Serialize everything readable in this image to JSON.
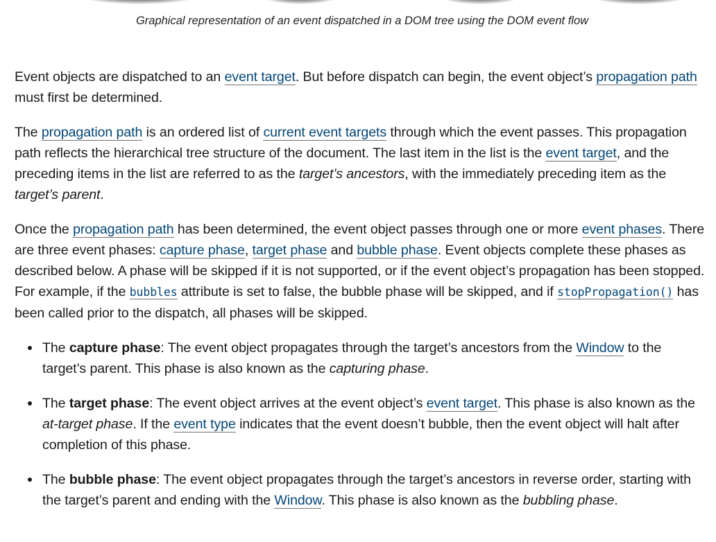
{
  "figure": {
    "caption": "Graphical representation of an event dispatched in a DOM tree using the DOM event flow"
  },
  "p1": {
    "t1": "Event objects are dispatched to an ",
    "l1": "event target",
    "t2": ". But before dispatch can begin, the event object’s ",
    "l2": "propagation path",
    "t3": " must first be determined."
  },
  "p2": {
    "t1": "The ",
    "l1": "propagation path",
    "t2": " is an ordered list of ",
    "l2": "current event targets",
    "t3": " through which the event passes. This propagation path reflects the hierarchical tree structure of the document. The last item in the list is the ",
    "l3": "event target",
    "t4": ", and the preceding items in the list are referred to as the ",
    "e1": "target’s ancestors",
    "t5": ", with the immediately preceding item as the ",
    "e2": "target’s parent",
    "t6": "."
  },
  "p3": {
    "t1": "Once the ",
    "l1": "propagation path",
    "t2": " has been determined, the event object passes through one or more ",
    "l2": "event phases",
    "t3": ". There are three event phases: ",
    "l3": "capture phase",
    "t4": ", ",
    "l4": "target phase",
    "t5": " and ",
    "l5": "bubble phase",
    "t6": ". Event objects complete these phases as described below. A phase will be skipped if it is not supported, or if the event object’s propagation has been stopped. For example, if the ",
    "c1": "bubbles",
    "t7": " attribute is set to false, the bubble phase will be skipped, and if ",
    "c2": "stopPropagation()",
    "t8": " has been called prior to the dispatch, all phases will be skipped."
  },
  "phases": [
    {
      "t1": "The ",
      "b1": "capture phase",
      "t2": ": The event object propagates through the target’s ancestors from the ",
      "l1": "Window",
      "t3": " to the target’s parent. This phase is also known as the ",
      "e1": "capturing phase",
      "t4": "."
    },
    {
      "t1": "The ",
      "b1": "target phase",
      "t2": ": The event object arrives at the event object’s ",
      "l1": "event target",
      "t3": ". This phase is also known as the ",
      "e1": "at-target phase",
      "t4": ". If the ",
      "l2": "event type",
      "t5": " indicates that the event doesn’t bubble, then the event object will halt after completion of this phase."
    },
    {
      "t1": "The ",
      "b1": "bubble phase",
      "t2": ": The event object propagates through the target’s ancestors in reverse order, starting with the target’s parent and ending with the ",
      "l1": "Window",
      "t3": ". This phase is also known as the ",
      "e1": "bubbling phase",
      "t4": "."
    }
  ]
}
